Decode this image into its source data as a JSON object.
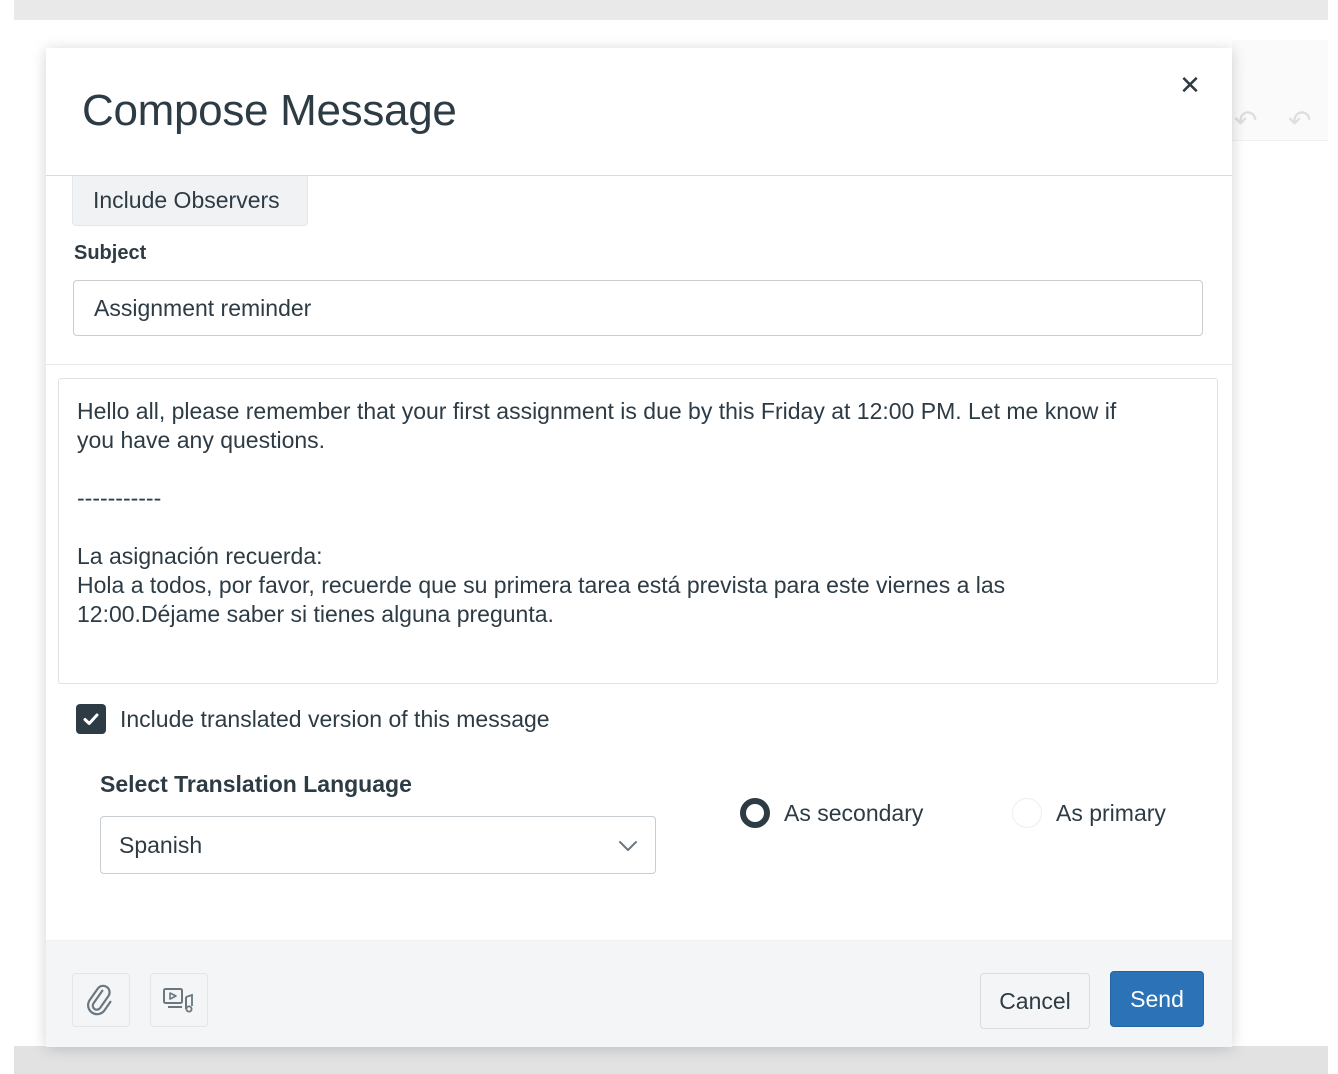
{
  "dialog": {
    "title": "Compose Message",
    "close_icon": "close-icon"
  },
  "recipients": {
    "include_observers_label": "Include Observers"
  },
  "subject": {
    "label": "Subject",
    "value": "Assignment reminder"
  },
  "message": {
    "body": "Hello all, please remember that your first assignment is due by this Friday at 12:00 PM. Let me know if\nyou have any questions.\n\n-----------\n\nLa asignación recuerda:\nHola a todos, por favor, recuerde que su primera tarea está prevista para este viernes a las\n12:00.Déjame saber si tienes alguna pregunta."
  },
  "translation": {
    "include_label": "Include translated version of this message",
    "include_checked": true,
    "language_label": "Select Translation Language",
    "language_value": "Spanish",
    "options": [
      {
        "label": "As secondary",
        "checked": true
      },
      {
        "label": "As primary",
        "checked": false
      }
    ]
  },
  "footer": {
    "attach_icon": "paperclip-icon",
    "media_icon": "media-icon",
    "cancel_label": "Cancel",
    "send_label": "Send"
  },
  "colors": {
    "primary_button": "#2b73b6",
    "text": "#2d3b45",
    "checkbox": "#2d3b45"
  }
}
